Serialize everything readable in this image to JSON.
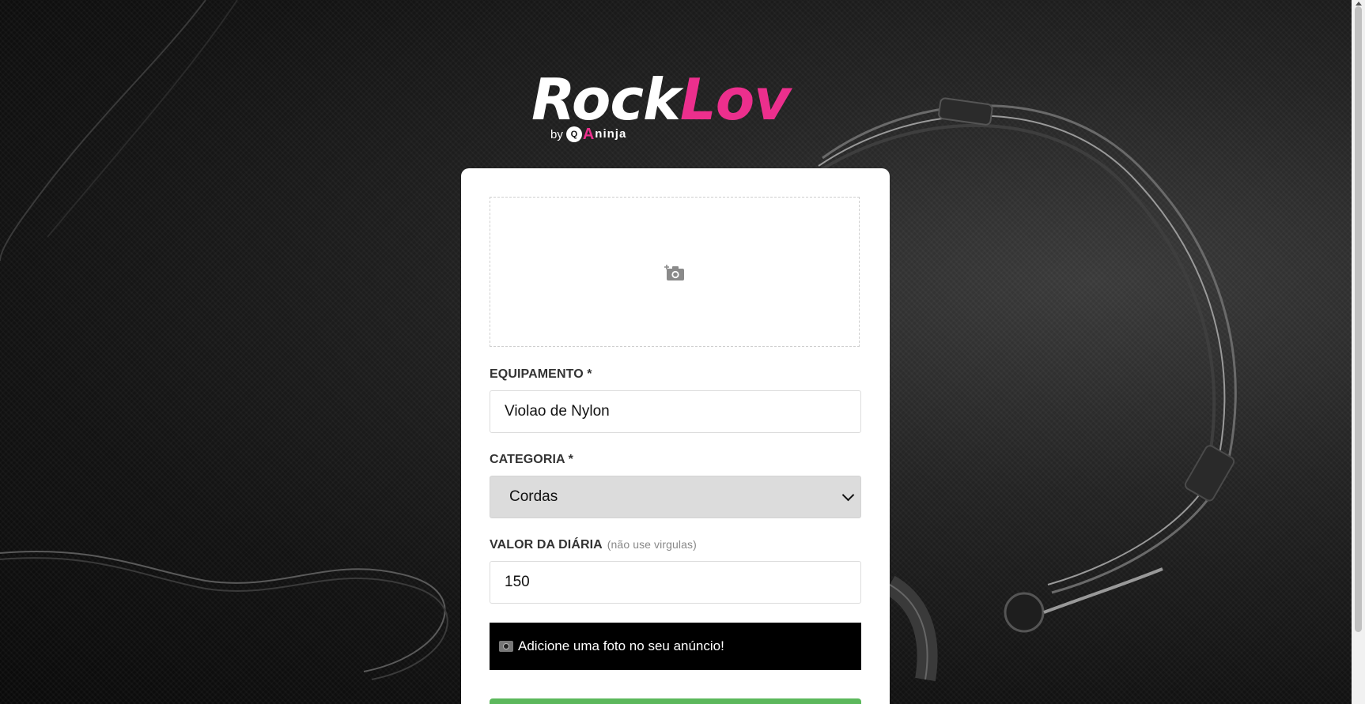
{
  "brand": {
    "name_part1": "Rock",
    "name_part2": "Lov",
    "by": "by",
    "badge_q": "Q",
    "badge_a": "A",
    "badge_ninja": "ninja",
    "colors": {
      "accent": "#ec2f8d",
      "white": "#ffffff"
    }
  },
  "form": {
    "upload_icon": "add-photo-icon",
    "equipment": {
      "label": "EQUIPAMENTO *",
      "value": "Violao de Nylon"
    },
    "category": {
      "label": "CATEGORIA *",
      "selected": "Cordas"
    },
    "price": {
      "label": "VALOR DA DIÁRIA",
      "hint": "(não use virgulas)",
      "value": "150"
    },
    "alert": {
      "icon": "camera-icon",
      "text": "Adicione uma foto no seu anúncio!"
    },
    "submit_color": "#5cb85c"
  }
}
